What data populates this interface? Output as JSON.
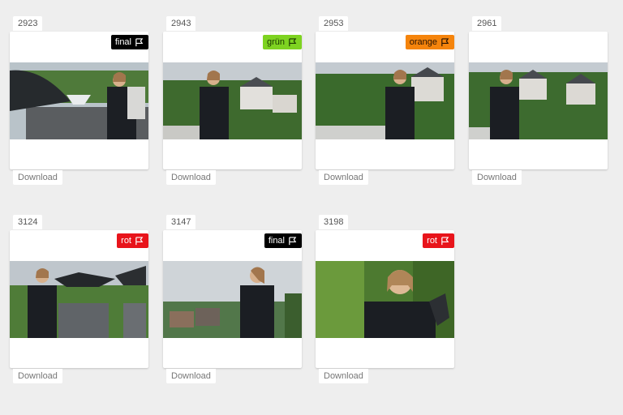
{
  "items": [
    {
      "number": "2923",
      "flag": "final",
      "flag_color": "#000000",
      "flag_text_color": "#ffffff",
      "download": "Download",
      "scene": "chimney"
    },
    {
      "number": "2943",
      "flag": "grün",
      "flag_color": "#7ed321",
      "flag_text_color": "#1b3a00",
      "download": "Download",
      "scene": "village"
    },
    {
      "number": "2953",
      "flag": "orange",
      "flag_color": "#f5840c",
      "flag_text_color": "#2a1300",
      "download": "Download",
      "scene": "village"
    },
    {
      "number": "2961",
      "flag": "",
      "flag_color": "",
      "flag_text_color": "",
      "download": "Download",
      "scene": "village"
    },
    {
      "number": "3124",
      "flag": "rot",
      "flag_color": "#e8141b",
      "flag_text_color": "#ffffff",
      "download": "Download",
      "scene": "chimney"
    },
    {
      "number": "3147",
      "flag": "final",
      "flag_color": "#000000",
      "flag_text_color": "#ffffff",
      "download": "Download",
      "scene": "sky"
    },
    {
      "number": "3198",
      "flag": "rot",
      "flag_color": "#e8141b",
      "flag_text_color": "#ffffff",
      "download": "Download",
      "scene": "green"
    }
  ]
}
